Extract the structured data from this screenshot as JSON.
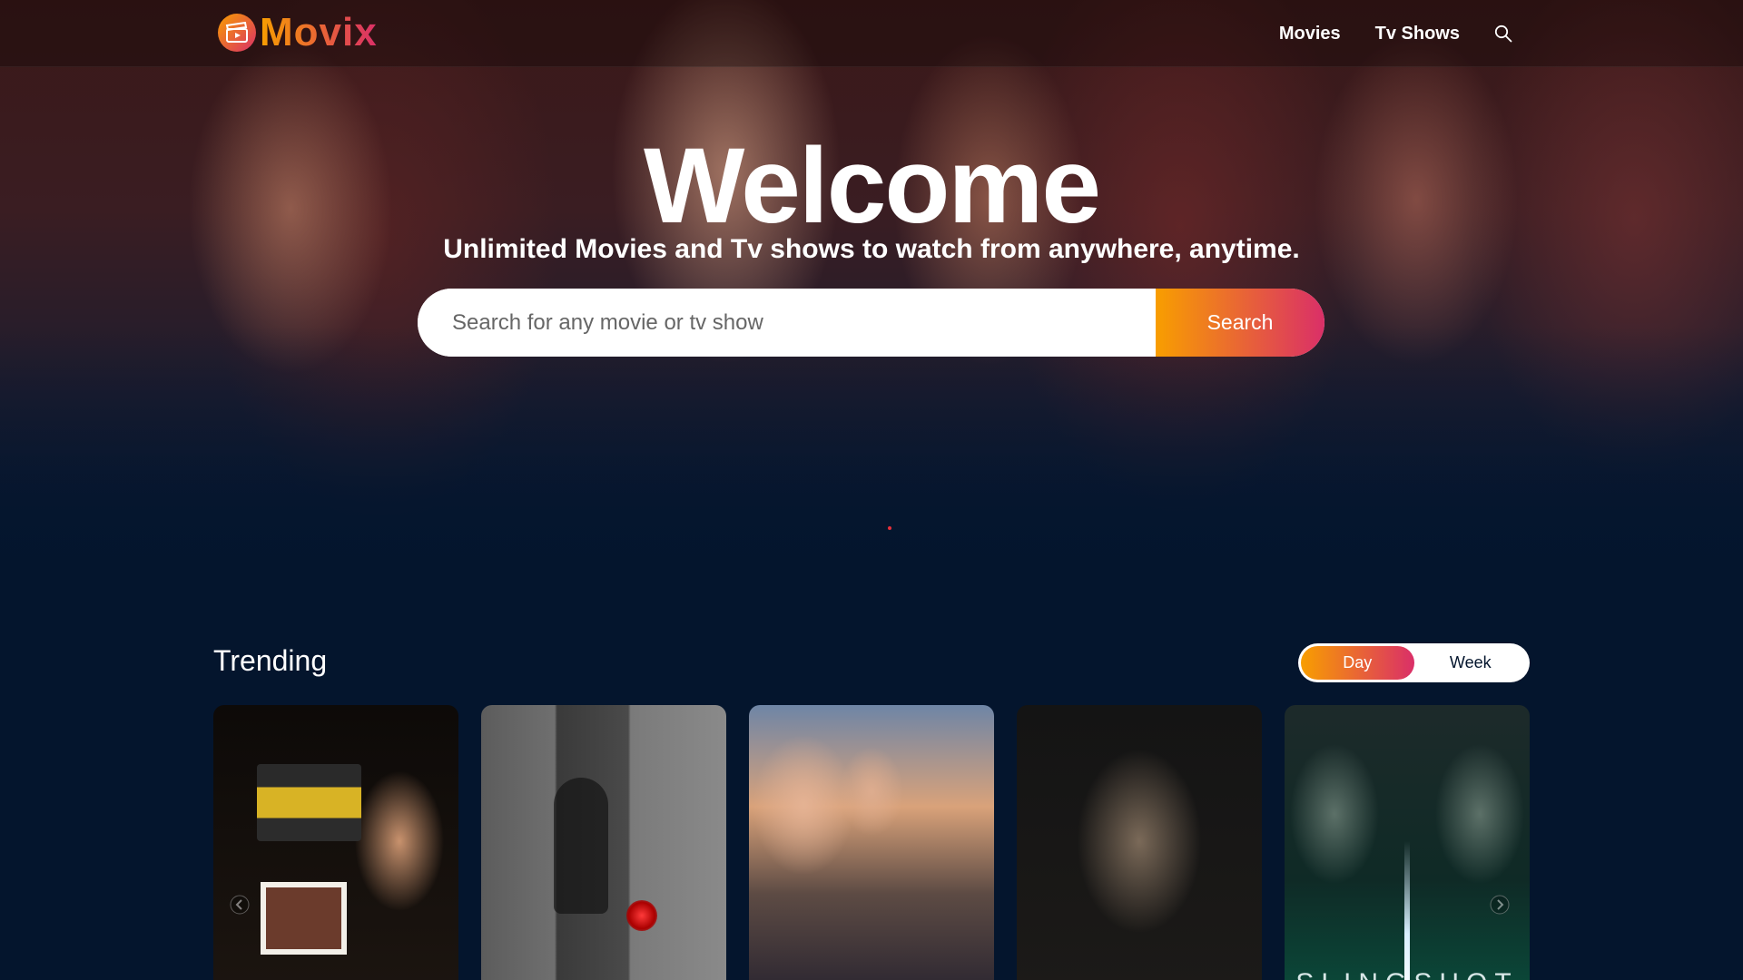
{
  "header": {
    "logo_text": "Movix",
    "nav": [
      {
        "label": "Movies"
      },
      {
        "label": "Tv Shows"
      }
    ],
    "search_icon": "search-icon"
  },
  "hero": {
    "title": "Welcome",
    "subtitle": "Unlimited Movies and Tv shows to watch from anywhere, anytime.",
    "search": {
      "placeholder": "Search for any movie or tv show",
      "value": "",
      "button_label": "Search"
    }
  },
  "trending": {
    "title": "Trending",
    "tabs": [
      {
        "label": "Day",
        "active": true
      },
      {
        "label": "Week",
        "active": false
      }
    ],
    "posters": [
      {
        "poster_text": ""
      },
      {
        "poster_text": ""
      },
      {
        "poster_text": ""
      },
      {
        "poster_text": ""
      },
      {
        "poster_text": "SLINGSHOT"
      }
    ],
    "arrows": [
      "arrow-left-icon",
      "arrow-right-icon"
    ]
  },
  "colors": {
    "background": "#04152d",
    "gradient_start": "#f89e00",
    "gradient_end": "#da2f68",
    "indicator_dot": "#e8303a"
  }
}
